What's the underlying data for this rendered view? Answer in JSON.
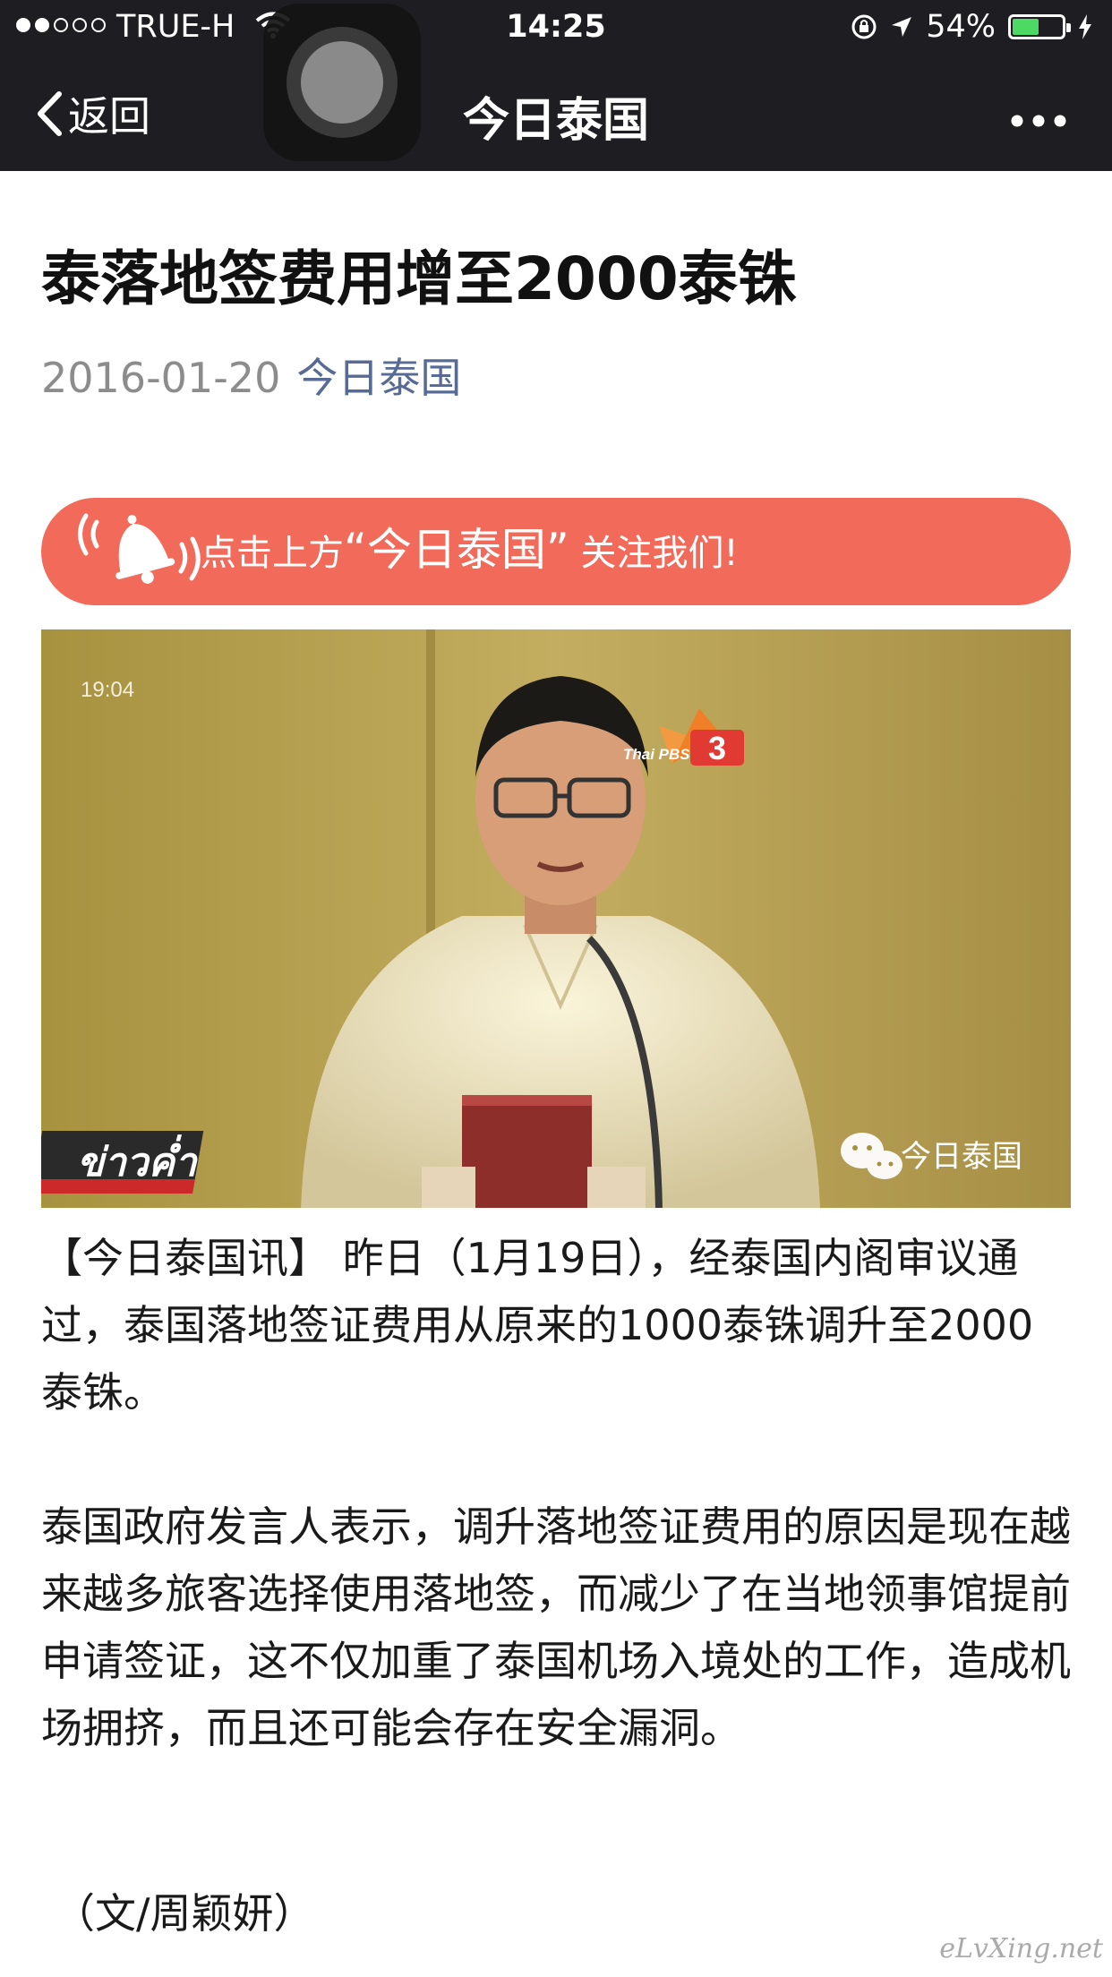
{
  "status_bar": {
    "carrier": "TRUE-H",
    "time": "14:25",
    "battery_percent": "54%",
    "battery_level": 0.54,
    "signal_bars_filled": 2,
    "signal_bars_total": 5
  },
  "nav": {
    "back_label": "返回",
    "title": "今日泰国",
    "more_icon": "more-dots-icon"
  },
  "article": {
    "title": "泰落地签费用增至2000泰铢",
    "date": "2016-01-20",
    "account": "今日泰国",
    "follow_banner": {
      "prefix": "点击上方",
      "highlight": "“今日泰国”",
      "suffix": " 关注我们!"
    },
    "image": {
      "time_overlay": "19:04",
      "channel_logo": "Thai PBS",
      "channel_number": "3",
      "program_text": "ข่าวค่ำ",
      "watermark": "今日泰国"
    },
    "paragraphs": [
      "【今日泰国讯】 昨日（1月19日），经泰国内阁审议通过，泰国落地签证费用从原来的1000泰铢调升至2000泰铢。",
      "泰国政府发言人表示，调升落地签证费用的原因是现在越来越多旅客选择使用落地签，而减少了在当地领事馆提前申请签证，这不仅加重了泰国机场入境处的工作，造成机场拥挤，而且还可能会存在安全漏洞。",
      "（文/周颖妍）"
    ]
  },
  "page_watermark": "eLvXing.net",
  "colors": {
    "nav_bg": "#1e1e22",
    "banner_bg": "#f26b5a",
    "account_link": "#576b95",
    "battery_fill": "#4cd964"
  }
}
